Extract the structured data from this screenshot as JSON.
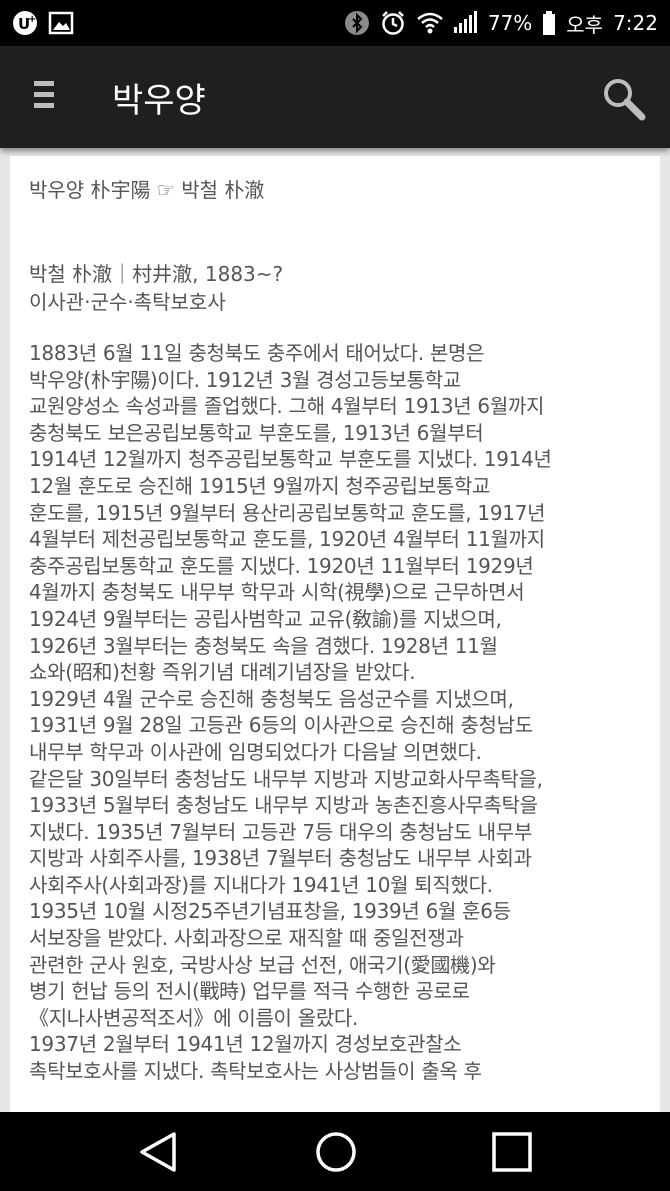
{
  "status_bar": {
    "battery_percent_label": "77%",
    "am_pm": "오후",
    "time": "7:22",
    "icons": [
      "u-plus-icon",
      "image-icon",
      "bluetooth-icon",
      "alarm-icon",
      "wifi-icon",
      "signal-icon",
      "battery-icon"
    ]
  },
  "app_bar": {
    "title": "박우양",
    "menu_icon": "menu-icon",
    "search_icon": "search-icon"
  },
  "content": {
    "entry_heading": "박우양 朴宇陽 ☞ 박철 朴澈",
    "person_head": "박철 朴澈｜村井澈, 1883~?",
    "person_role": "이사관·군수·촉탁보호사",
    "bio_lines": [
      "1883년 6월 11일 충청북도 충주에서 태어났다. 본명은",
      "박우양(朴宇陽)이다. 1912년 3월 경성고등보통학교",
      "교원양성소 속성과를 졸업했다. 그해 4월부터 1913년 6월까지",
      "충청북도 보은공립보통학교 부훈도를, 1913년 6월부터",
      "1914년 12월까지 청주공립보통학교 부훈도를 지냈다. 1914년",
      "12월 훈도로 승진해 1915년 9월까지 청주공립보통학교",
      "훈도를, 1915년 9월부터 용산리공립보통학교 훈도를, 1917년",
      "4월부터 제천공립보통학교 훈도를, 1920년 4월부터 11월까지",
      "충주공립보통학교 훈도를 지냈다. 1920년 11월부터 1929년",
      "4월까지 충청북도 내무부 학무과 시학(視學)으로 근무하면서",
      "1924년 9월부터는 공립사범학교 교유(敎諭)를 지냈으며,",
      "1926년 3월부터는 충청북도 속을 겸했다. 1928년 11월",
      "쇼와(昭和)천황 즉위기념 대례기념장을 받았다.",
      "1929년 4월 군수로 승진해 충청북도 음성군수를 지냈으며,",
      "1931년 9월 28일 고등관 6등의 이사관으로 승진해 충청남도",
      "내무부 학무과 이사관에 임명되었다가 다음날 의면했다.",
      "같은달 30일부터 충청남도 내무부 지방과 지방교화사무촉탁을,",
      "1933년 5월부터 충청남도 내무부 지방과 농촌진흥사무촉탁을",
      "지냈다. 1935년 7월부터 고등관 7등 대우의 충청남도 내무부",
      "지방과 사회주사를, 1938년 7월부터 충청남도 내무부 사회과",
      "사회주사(사회과장)를 지내다가 1941년 10월 퇴직했다.",
      "1935년 10월 시정25주년기념표창을, 1939년 6월 훈6등",
      "서보장을 받았다. 사회과장으로 재직할 때 중일전쟁과",
      "관련한 군사 원호, 국방사상 보급 선전, 애국기(愛國機)와",
      "병기 헌납 등의 전시(戰時) 업무를 적극 수행한 공로로",
      "《지나사변공적조서》에 이름이 올랐다.",
      "1937년 2월부터 1941년 12월까지 경성보호관찰소",
      "촉탁보호사를 지냈다. 촉탁보호사는 사상범들이 출옥 후"
    ]
  },
  "nav_bar": {
    "icons": [
      "back-icon",
      "home-icon",
      "recent-apps-icon"
    ]
  }
}
